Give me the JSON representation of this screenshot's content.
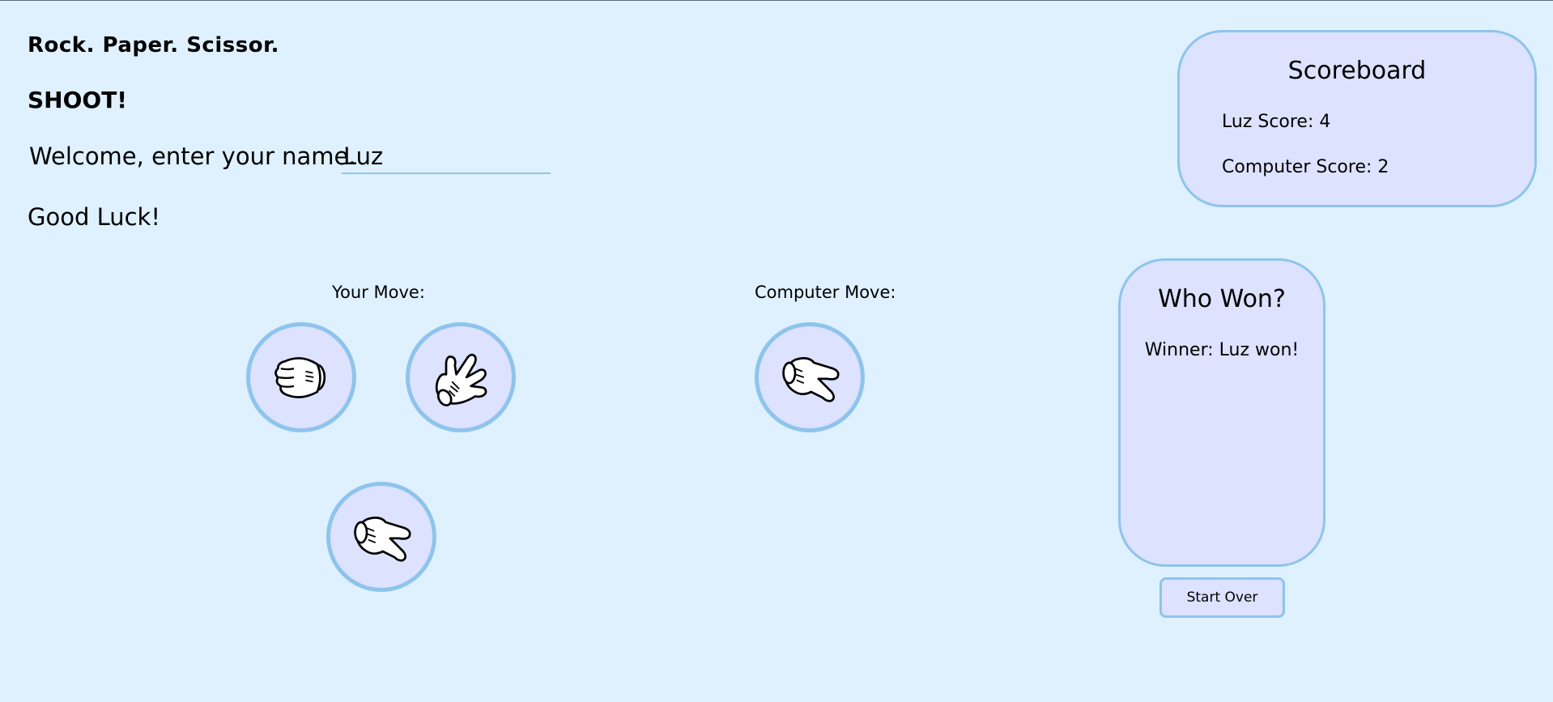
{
  "header": {
    "title_line1": "Rock. Paper. Scissor.",
    "title_line2": "SHOOT!",
    "welcome_prompt": "Welcome, enter your name.",
    "name_value": "Luz",
    "good_luck": "Good Luck!"
  },
  "player": {
    "label": "Your Move:",
    "moves": [
      {
        "name": "rock",
        "icon": "rock-hand-icon"
      },
      {
        "name": "paper",
        "icon": "paper-hand-icon"
      },
      {
        "name": "scissors",
        "icon": "scissors-hand-icon"
      }
    ]
  },
  "computer": {
    "label": "Computer Move:",
    "move": {
      "name": "scissors",
      "icon": "scissors-hand-icon"
    }
  },
  "scoreboard": {
    "title": "Scoreboard",
    "player_score": "Luz Score: 4",
    "computer_score": "Computer Score: 2"
  },
  "result": {
    "title": "Who Won?",
    "winner_text": "Winner: Luz won!"
  },
  "controls": {
    "start_over_label": "Start Over"
  },
  "colors": {
    "background": "#dff1ff",
    "panel_fill": "#dde2ff",
    "accent_border": "#8ec4ec"
  }
}
